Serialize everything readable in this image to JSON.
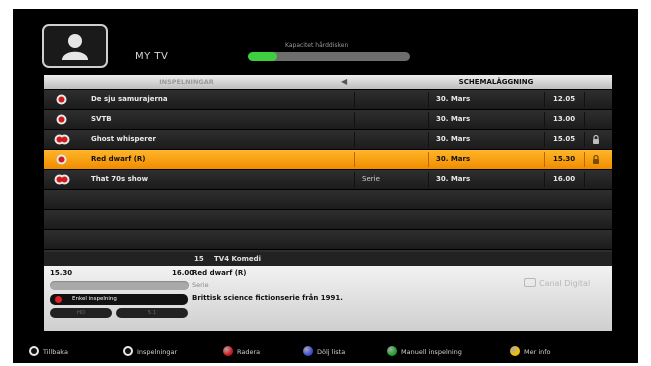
{
  "header": {
    "title": "MY TV",
    "capacity_label": "Kapacitet hårddisken",
    "capacity_used_fraction": 0.18,
    "capacity_color": "#3ecf3e"
  },
  "tabs": {
    "recordings": "INSPELNINGAR",
    "schedule": "SCHEMALÄGGNING"
  },
  "recordings": [
    {
      "title": "De sju samurajerna",
      "genre": "",
      "date": "30. Mars",
      "time": "12.05",
      "locked": false,
      "icon": "record-single-icon"
    },
    {
      "title": "SVTB",
      "genre": "",
      "date": "30. Mars",
      "time": "13.00",
      "locked": false,
      "icon": "record-single-icon"
    },
    {
      "title": "Ghost whisperer",
      "genre": "",
      "date": "30. Mars",
      "time": "15.05",
      "locked": true,
      "icon": "record-series-icon"
    },
    {
      "title": "Red dwarf (R)",
      "genre": "",
      "date": "30. Mars",
      "time": "15.30",
      "locked": true,
      "icon": "record-single-icon",
      "selected": true
    },
    {
      "title": "That 70s show",
      "genre": "Serie",
      "date": "30. Mars",
      "time": "16.00",
      "locked": false,
      "icon": "record-series-icon"
    }
  ],
  "empty_rows": 4,
  "info": {
    "channel_number": "15",
    "channel_name": "TV4 Komedi",
    "start_time": "15.30",
    "end_time": "16.00",
    "program_title": "Red dwarf (R)",
    "genre": "Serie",
    "description": "Brittisk science fictionserie från 1991.",
    "recording_type": "Enkel inspelning",
    "hd_label": "HD",
    "audio_label": "5.1",
    "brand": "Canal Digital"
  },
  "footer": [
    {
      "label": "Tillbaka",
      "icon": "back-icon",
      "color": "#ffffff"
    },
    {
      "label": "Inspelningar",
      "icon": "recordings-icon",
      "color": "#ffffff"
    },
    {
      "label": "Radera",
      "icon": "red-button-icon",
      "color": "#d01818"
    },
    {
      "label": "Dölj lista",
      "icon": "blue-button-icon",
      "color": "#3a4fd8"
    },
    {
      "label": "Manuell inspelning",
      "icon": "green-button-icon",
      "color": "#1fa02a"
    },
    {
      "label": "Mer info",
      "icon": "yellow-button-icon",
      "color": "#f2c200"
    }
  ]
}
